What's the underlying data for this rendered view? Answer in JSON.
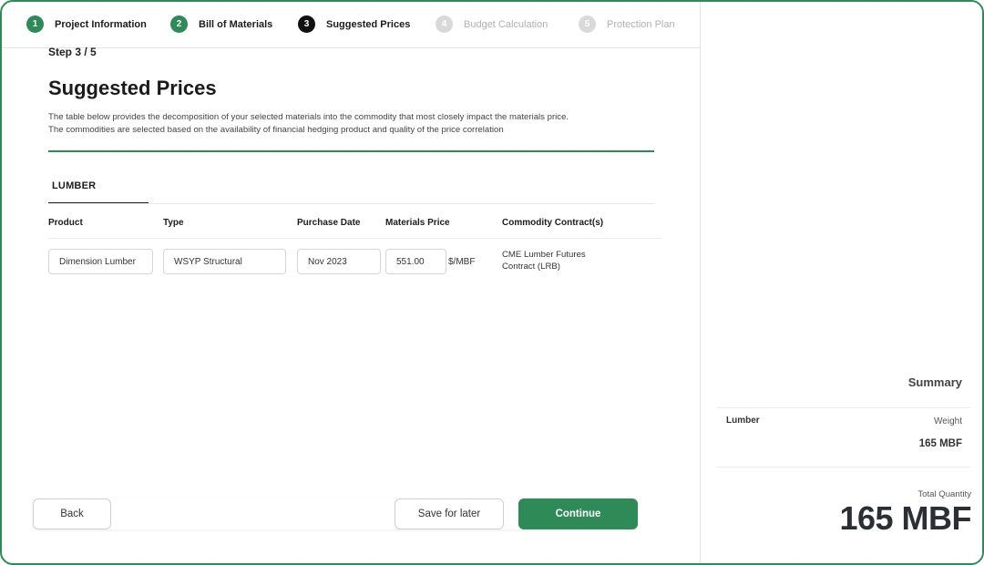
{
  "stepper": {
    "steps": [
      {
        "number": "1",
        "label": "Project Information",
        "state": "done"
      },
      {
        "number": "2",
        "label": "Bill of Materials",
        "state": "done"
      },
      {
        "number": "3",
        "label": "Suggested Prices",
        "state": "active"
      },
      {
        "number": "4",
        "label": "Budget Calculation",
        "state": "todo"
      },
      {
        "number": "5",
        "label": "Protection Plan",
        "state": "todo"
      }
    ]
  },
  "main": {
    "step_counter": "Step 3 / 5",
    "title": "Suggested Prices",
    "description_line1": "The table below provides the decomposition of your selected materials into the commodity that most closely impact the materials price.",
    "description_line2": "The commodities are selected based on the availability of financial hedging product and quality of the price correlation",
    "tab_label": "LUMBER",
    "table": {
      "headers": [
        "Product",
        "Type",
        "Purchase Date",
        "Materials Price",
        "Commodity Contract(s)"
      ],
      "rows": [
        {
          "product": "Dimension Lumber",
          "type": "WSYP Structural",
          "purchase_date": "Nov 2023",
          "materials_price": "551.00",
          "price_unit": "$/MBF",
          "commodity_line1": "CME Lumber Futures",
          "commodity_line2": "Contract (LRB)"
        }
      ]
    }
  },
  "footer": {
    "back_label": "Back",
    "save_label": "Save for later",
    "continue_label": "Continue"
  },
  "summary": {
    "title": "Summary",
    "material": "Lumber",
    "weight_label": "Weight",
    "weight_value": "165 MBF",
    "total_quantity_label": "Total Quantity",
    "total_quantity_value": "165 MBF"
  },
  "colors": {
    "accent": "#2e8b57",
    "active_step": "#111111",
    "inactive_step": "#d9d9d9"
  }
}
